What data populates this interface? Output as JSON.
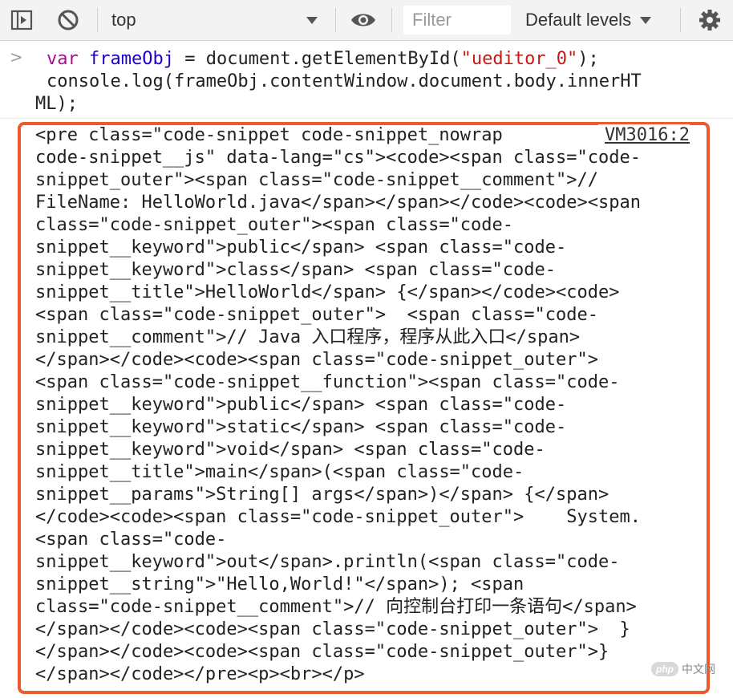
{
  "toolbar": {
    "context": "top",
    "filter_placeholder": "Filter",
    "levels": "Default levels",
    "icons": [
      "sidebar-toggle-icon",
      "clear-console-icon",
      "dropdown-arrow-icon",
      "eye-icon",
      "levels-arrow-icon",
      "gear-icon"
    ]
  },
  "console": {
    "prompt": ">",
    "input_line1_kw": "var",
    "input_line1_ident": "frameObj",
    "input_line1_mid": " = document.getElementById(",
    "input_line1_str": "\"ueditor_0\"",
    "input_line1_end": ");",
    "input_line2": "console.log(frameObj.contentWindow.document.body.innerHT",
    "input_line3": "ML);",
    "source": "VM3016:2",
    "output": "<pre class=\"code-snippet code-snippet_nowrap\ncode-snippet__js\" data-lang=\"cs\"><code><span class=\"code-\nsnippet_outer\"><span class=\"code-snippet__comment\">//\nFileName: HelloWorld.java</span></span></code><code><span\nclass=\"code-snippet_outer\"><span class=\"code-\nsnippet__keyword\">public</span> <span class=\"code-\nsnippet__keyword\">class</span> <span class=\"code-\nsnippet__title\">HelloWorld</span> {</span></code><code>\n<span class=\"code-snippet_outer\">  <span class=\"code-\nsnippet__comment\">// Java 入口程序，程序从此入口</span>\n</span></code><code><span class=\"code-snippet_outer\">\n<span class=\"code-snippet__function\"><span class=\"code-\nsnippet__keyword\">public</span> <span class=\"code-\nsnippet__keyword\">static</span> <span class=\"code-\nsnippet__keyword\">void</span> <span class=\"code-\nsnippet__title\">main</span>(<span class=\"code-\nsnippet__params\">String[] args</span>)</span> {</span>\n</code><code><span class=\"code-snippet_outer\">    System.\n<span class=\"code-\nsnippet__keyword\">out</span>.println(<span class=\"code-\nsnippet__string\">\"Hello,World!\"</span>); <span\nclass=\"code-snippet__comment\">// 向控制台打印一条语句</span>\n</span></code><code><span class=\"code-snippet_outer\">  }\n</span></code><code><span class=\"code-snippet_outer\">}\n</span></code></pre><p><br></p>"
  },
  "watermark": {
    "badge": "php",
    "text": "中文网"
  }
}
